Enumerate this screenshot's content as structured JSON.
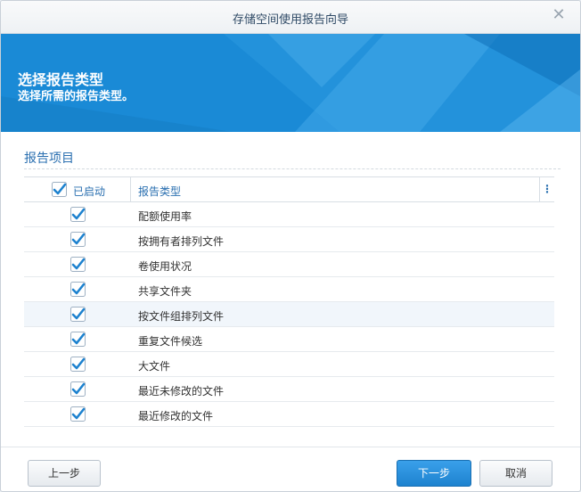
{
  "window": {
    "title": "存储空间使用报告向导"
  },
  "banner": {
    "title": "选择报告类型",
    "subtitle": "选择所需的报告类型。"
  },
  "section": {
    "title": "报告项目"
  },
  "grid": {
    "header": {
      "enabled_label": "已启动",
      "type_label": "报告类型",
      "menu_glyph": "⋮",
      "all_checked": true
    },
    "rows": [
      {
        "label": "配额使用率",
        "checked": true
      },
      {
        "label": "按拥有者排列文件",
        "checked": true
      },
      {
        "label": "卷使用状况",
        "checked": true
      },
      {
        "label": "共享文件夹",
        "checked": true
      },
      {
        "label": "按文件组排列文件",
        "checked": true
      },
      {
        "label": "重复文件候选",
        "checked": true
      },
      {
        "label": "大文件",
        "checked": true
      },
      {
        "label": "最近未修改的文件",
        "checked": true
      },
      {
        "label": "最近修改的文件",
        "checked": true
      }
    ]
  },
  "buttons": {
    "prev": "上一步",
    "next": "下一步",
    "cancel": "取消"
  },
  "colors": {
    "accent": "#1a8ad6",
    "check": "#1d82cf",
    "header_text": "#2a6fb0"
  },
  "icons": {
    "close": "close-icon",
    "check": "checkbox-checked-icon",
    "menu": "column-menu-icon"
  }
}
